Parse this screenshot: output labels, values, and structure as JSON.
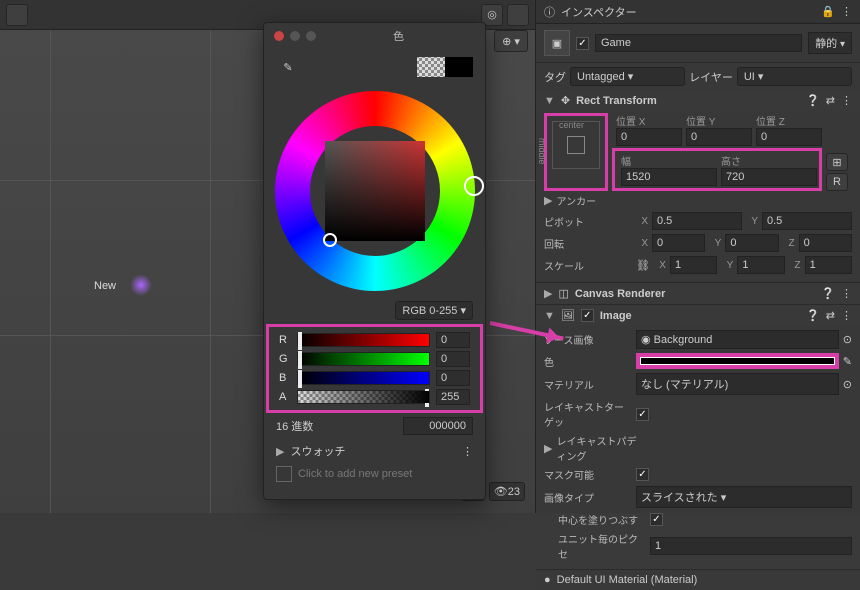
{
  "scene": {
    "object_label": "New"
  },
  "color_popup": {
    "title": "色",
    "mode": "RGB 0-255",
    "r_label": "R",
    "g_label": "G",
    "b_label": "B",
    "a_label": "A",
    "r": "0",
    "g": "0",
    "b": "0",
    "a": "255",
    "hex_label": "16 進数",
    "hex": "000000",
    "swatch_label": "スウォッチ",
    "preset_hint": "Click to add new preset"
  },
  "inspector": {
    "title": "インスペクター",
    "object_name": "Game",
    "static_label": "静的",
    "tag_label": "タグ",
    "tag_value": "Untagged",
    "layer_label": "レイヤー",
    "layer_value": "UI",
    "rect": {
      "title": "Rect Transform",
      "anchor_center": "center",
      "anchor_middle": "middle",
      "pos_x_label": "位置 X",
      "pos_y_label": "位置 Y",
      "pos_z_label": "位置 Z",
      "pos_x": "0",
      "pos_y": "0",
      "pos_z": "0",
      "width_label": "幅",
      "height_label": "高さ",
      "width": "1520",
      "height": "720",
      "anchors_label": "アンカー",
      "pivot_label": "ピボット",
      "pivot_x": "0.5",
      "pivot_y": "0.5",
      "rotation_label": "回転",
      "rot_x": "0",
      "rot_y": "0",
      "rot_z": "0",
      "scale_label": "スケール",
      "scale_x": "1",
      "scale_y": "1",
      "scale_z": "1",
      "r_button": "R"
    },
    "canvas_renderer": {
      "title": "Canvas Renderer"
    },
    "image": {
      "title": "Image",
      "source_label": "ソース画像",
      "source_value": "Background",
      "color_label": "色",
      "material_label": "マテリアル",
      "material_value": "なし (マテリアル)",
      "raycast_label": "レイキャストターゲッ",
      "padding_label": "レイキャストパディング",
      "maskable_label": "マスク可能",
      "type_label": "画像タイプ",
      "type_value": "スライスされた",
      "fill_label": "中心を塗りつぶす",
      "ppu_label": "ユニット毎のピクセ",
      "ppu_value": "1"
    },
    "material_footer": "Default UI Material (Material)",
    "view_count": "23"
  }
}
